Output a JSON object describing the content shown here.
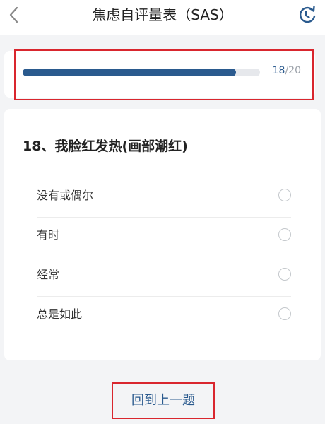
{
  "header": {
    "title": "焦虑自评量表（SAS）",
    "back_icon": "chevron-left-icon",
    "reset_icon": "refresh-icon"
  },
  "progress": {
    "current": "18",
    "total": "/20",
    "fraction": 0.9
  },
  "question": {
    "text": "18、我脸红发热(画部潮红)",
    "options": [
      {
        "label": "没有或偶尔"
      },
      {
        "label": "有时"
      },
      {
        "label": "经常"
      },
      {
        "label": "总是如此"
      }
    ]
  },
  "footer": {
    "prev_label": "回到上一题"
  },
  "colors": {
    "accent": "#2a5a8e",
    "highlight": "#d9262e",
    "track": "#e6e8ec",
    "background": "#f3f4f6"
  }
}
